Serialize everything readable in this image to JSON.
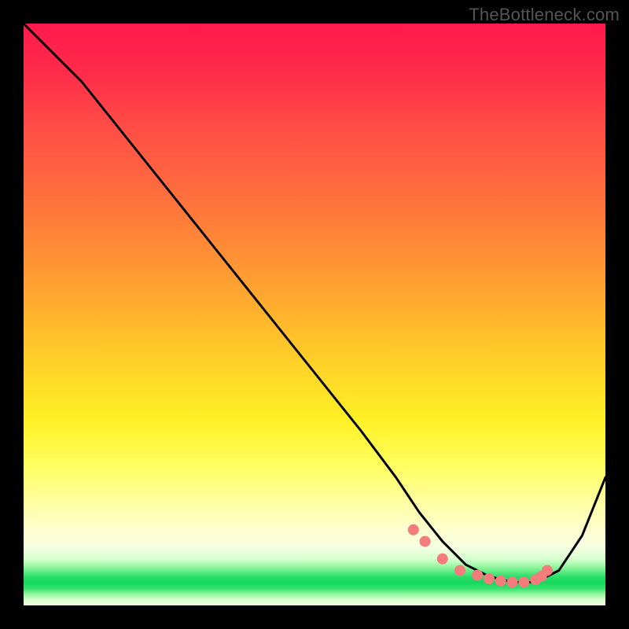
{
  "watermark": "TheBottleneck.com",
  "chart_data": {
    "type": "line",
    "title": "",
    "xlabel": "",
    "ylabel": "",
    "xlim": [
      0,
      100
    ],
    "ylim": [
      0,
      100
    ],
    "grid": false,
    "series": [
      {
        "name": "curve",
        "color": "#000000",
        "x": [
          0,
          4,
          10,
          18,
          26,
          34,
          42,
          50,
          58,
          64,
          68,
          72,
          76,
          80,
          84,
          88,
          92,
          96,
          100
        ],
        "y": [
          100,
          96,
          90,
          80,
          70,
          60,
          50,
          40,
          30,
          22,
          16,
          11,
          7,
          5,
          4,
          4,
          6,
          12,
          22
        ]
      }
    ],
    "markers": {
      "name": "highlight-dots",
      "color": "#f47c7c",
      "x": [
        67,
        69,
        72,
        75,
        78,
        80,
        82,
        84,
        86,
        88,
        89,
        90
      ],
      "y": [
        13,
        11,
        8,
        6,
        5.2,
        4.6,
        4.2,
        4,
        4,
        4.4,
        5,
        6
      ]
    }
  }
}
